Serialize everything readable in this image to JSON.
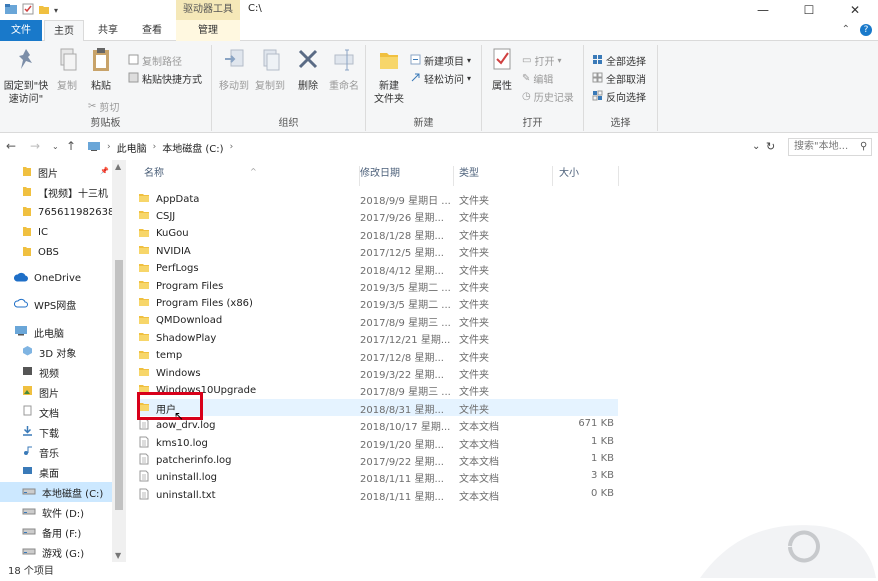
{
  "window": {
    "title": "C:\\",
    "context_tool": "驱动器工具"
  },
  "tabs": {
    "file": "文件",
    "home": "主页",
    "share": "共享",
    "view": "查看",
    "manage": "管理"
  },
  "ribbon": {
    "clipboard": {
      "pin": "固定到\"快速访问\"",
      "copy": "复制",
      "paste": "粘贴",
      "copy_path": "复制路径",
      "paste_shortcut": "粘贴快捷方式",
      "cut": "剪切",
      "label": "剪贴板"
    },
    "organize": {
      "move_to": "移动到",
      "copy_to": "复制到",
      "delete": "删除",
      "rename": "重命名",
      "label": "组织"
    },
    "new": {
      "new_folder": "新建\n文件夹",
      "new_item": "新建项目",
      "easy_access": "轻松访问",
      "label": "新建"
    },
    "open": {
      "properties": "属性",
      "open": "打开",
      "edit": "编辑",
      "history": "历史记录",
      "label": "打开"
    },
    "select": {
      "select_all": "全部选择",
      "select_none": "全部取消",
      "invert": "反向选择",
      "label": "选择"
    }
  },
  "address": {
    "crumb1": "此电脑",
    "crumb2": "本地磁盘 (C:)",
    "search_placeholder": "搜索\"本地..."
  },
  "nav": {
    "items": [
      {
        "label": "图片",
        "icon": "folder"
      },
      {
        "label": "【视频】十三机",
        "icon": "folder"
      },
      {
        "label": "765611982638",
        "icon": "folder"
      },
      {
        "label": "IC",
        "icon": "folder"
      },
      {
        "label": "OBS",
        "icon": "folder"
      },
      {
        "label": "OneDrive",
        "icon": "cloud"
      },
      {
        "label": "WPS网盘",
        "icon": "cloud"
      },
      {
        "label": "此电脑",
        "icon": "pc"
      },
      {
        "label": "3D 对象",
        "icon": "cube"
      },
      {
        "label": "视频",
        "icon": "video"
      },
      {
        "label": "图片",
        "icon": "picture"
      },
      {
        "label": "文档",
        "icon": "doc"
      },
      {
        "label": "下载",
        "icon": "download"
      },
      {
        "label": "音乐",
        "icon": "music"
      },
      {
        "label": "桌面",
        "icon": "desktop"
      },
      {
        "label": "本地磁盘 (C:)",
        "icon": "drive"
      },
      {
        "label": "软件 (D:)",
        "icon": "drive"
      },
      {
        "label": "备用 (F:)",
        "icon": "drive"
      },
      {
        "label": "游戏 (G:)",
        "icon": "drive"
      }
    ]
  },
  "columns": {
    "name": "名称",
    "date": "修改日期",
    "type": "类型",
    "size": "大小"
  },
  "files": [
    {
      "name": "AppData",
      "date": "2018/9/9 星期日 ...",
      "type": "文件夹",
      "size": "",
      "kind": "folder"
    },
    {
      "name": "CSJJ",
      "date": "2017/9/26 星期...",
      "type": "文件夹",
      "size": "",
      "kind": "folder"
    },
    {
      "name": "KuGou",
      "date": "2018/1/28 星期...",
      "type": "文件夹",
      "size": "",
      "kind": "folder"
    },
    {
      "name": "NVIDIA",
      "date": "2017/12/5 星期...",
      "type": "文件夹",
      "size": "",
      "kind": "folder"
    },
    {
      "name": "PerfLogs",
      "date": "2018/4/12 星期...",
      "type": "文件夹",
      "size": "",
      "kind": "folder"
    },
    {
      "name": "Program Files",
      "date": "2019/3/5 星期二 ...",
      "type": "文件夹",
      "size": "",
      "kind": "folder"
    },
    {
      "name": "Program Files (x86)",
      "date": "2019/3/5 星期二 ...",
      "type": "文件夹",
      "size": "",
      "kind": "folder"
    },
    {
      "name": "QMDownload",
      "date": "2017/8/9 星期三 ...",
      "type": "文件夹",
      "size": "",
      "kind": "folder"
    },
    {
      "name": "ShadowPlay",
      "date": "2017/12/21 星期...",
      "type": "文件夹",
      "size": "",
      "kind": "folder"
    },
    {
      "name": "temp",
      "date": "2017/12/8 星期...",
      "type": "文件夹",
      "size": "",
      "kind": "folder"
    },
    {
      "name": "Windows",
      "date": "2019/3/22 星期...",
      "type": "文件夹",
      "size": "",
      "kind": "folder"
    },
    {
      "name": "Windows10Upgrade",
      "date": "2017/8/9 星期三 ...",
      "type": "文件夹",
      "size": "",
      "kind": "folder"
    },
    {
      "name": "用户",
      "date": "2018/8/31 星期...",
      "type": "文件夹",
      "size": "",
      "kind": "folder"
    },
    {
      "name": "aow_drv.log",
      "date": "2018/10/17 星期...",
      "type": "文本文档",
      "size": "671 KB",
      "kind": "file"
    },
    {
      "name": "kms10.log",
      "date": "2019/1/20 星期...",
      "type": "文本文档",
      "size": "1 KB",
      "kind": "file"
    },
    {
      "name": "patcherinfo.log",
      "date": "2017/9/22 星期...",
      "type": "文本文档",
      "size": "1 KB",
      "kind": "file"
    },
    {
      "name": "uninstall.log",
      "date": "2018/1/11 星期...",
      "type": "文本文档",
      "size": "3 KB",
      "kind": "file"
    },
    {
      "name": "uninstall.txt",
      "date": "2018/1/11 星期...",
      "type": "文本文档",
      "size": "0 KB",
      "kind": "file"
    }
  ],
  "status": {
    "count": "18 个项目"
  },
  "colors": {
    "accent": "#1979ca",
    "folder": "#f0c040",
    "highlight": "#d8001a",
    "nav_selected": "#cce8ff"
  }
}
